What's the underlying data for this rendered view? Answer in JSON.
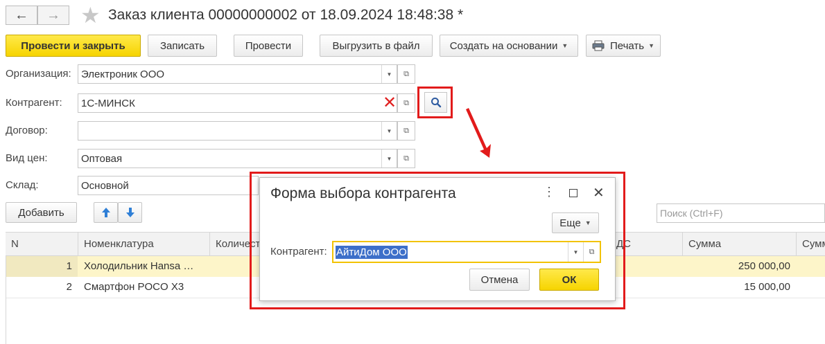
{
  "window": {
    "title": "Заказ клиента 00000000002 от 18.09.2024 18:48:38 *"
  },
  "toolbar": {
    "post_and_close": "Провести и закрыть",
    "save": "Записать",
    "post": "Провести",
    "export": "Выгрузить в файл",
    "create_based_on": "Создать на основании",
    "print": "Печать"
  },
  "form": {
    "organization": {
      "label": "Организация:",
      "value": "Электроник ООО"
    },
    "counterparty": {
      "label": "Контрагент:",
      "value": "1С-МИНСК"
    },
    "contract": {
      "label": "Договор:",
      "value": ""
    },
    "price_type": {
      "label": "Вид цен:",
      "value": "Оптовая"
    },
    "warehouse": {
      "label": "Склад:",
      "value": "Основной"
    }
  },
  "table_toolbar": {
    "add": "Добавить",
    "search_placeholder": "Поиск (Ctrl+F)"
  },
  "table": {
    "columns": [
      "N",
      "Номенклатура",
      "Количест",
      "ДС",
      "Сумма",
      "Сумм"
    ],
    "rows": [
      {
        "n": "1",
        "item": "Холодильник Hansa …",
        "sum": "250 000,00"
      },
      {
        "n": "2",
        "item": "Смартфон POCO X3",
        "sum": "15 000,00"
      }
    ]
  },
  "dialog": {
    "title": "Форма выбора контрагента",
    "more": "Еще",
    "field_label": "Контрагент:",
    "field_value": "АйтиДом ООО",
    "cancel": "Отмена",
    "ok": "ОК"
  },
  "colors": {
    "accent_yellow": "#f6d400",
    "highlight_red": "#e21b1b",
    "selected_row": "#fdf5c9",
    "text_selection": "#3d6fc9"
  }
}
